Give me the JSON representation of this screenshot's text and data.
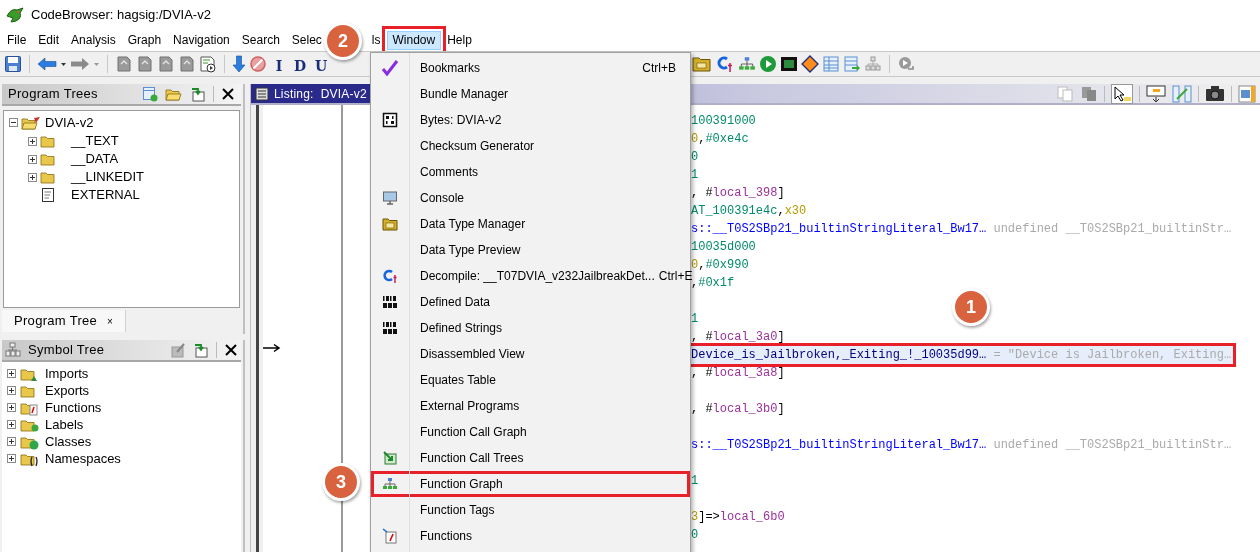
{
  "window": {
    "title": "CodeBrowser: hagsig:/DVIA-v2"
  },
  "menubar": [
    {
      "label": "File",
      "selected": false,
      "marked": false
    },
    {
      "label": "Edit",
      "selected": false,
      "marked": false
    },
    {
      "label": "Analysis",
      "selected": false,
      "marked": false
    },
    {
      "label": "Graph",
      "selected": false,
      "marked": false
    },
    {
      "label": "Navigation",
      "selected": false,
      "marked": false
    },
    {
      "label": "Search",
      "selected": false,
      "marked": false
    },
    {
      "label": "Selec",
      "selected": false,
      "marked": false
    },
    {
      "label": "ls",
      "selected": false,
      "marked": false
    },
    {
      "label": "Window",
      "selected": true,
      "marked": true
    },
    {
      "label": "Help",
      "selected": false,
      "marked": false
    }
  ],
  "toolbar": {
    "letter_buttons": [
      "I",
      "D",
      "U"
    ]
  },
  "program_trees": {
    "title": "Program Trees",
    "tree": [
      {
        "label": "DVIA-v2",
        "kind": "program",
        "expanded": true,
        "children": [
          {
            "label": "__TEXT",
            "kind": "folder",
            "expanded": false
          },
          {
            "label": "__DATA",
            "kind": "folder",
            "expanded": false
          },
          {
            "label": "__LINKEDIT",
            "kind": "folder",
            "expanded": false
          },
          {
            "label": "EXTERNAL",
            "kind": "file"
          }
        ]
      }
    ],
    "tab": {
      "label": "Program Tree",
      "close": "×"
    }
  },
  "symbol_tree": {
    "title": "Symbol Tree",
    "items": [
      {
        "label": "Imports",
        "kind": "imports",
        "expanded": false
      },
      {
        "label": "Exports",
        "kind": "exports",
        "expanded": false
      },
      {
        "label": "Functions",
        "kind": "functions",
        "expanded": false
      },
      {
        "label": "Labels",
        "kind": "labels",
        "expanded": false
      },
      {
        "label": "Classes",
        "kind": "classes",
        "expanded": false
      },
      {
        "label": "Namespaces",
        "kind": "namespaces",
        "expanded": false
      }
    ]
  },
  "listing": {
    "title": "Listing:  DVIA-v2",
    "lines": [
      {
        "kind": "code",
        "selected": false,
        "marked": false,
        "parts": [
          {
            "kind": "number",
            "text": "100391000"
          }
        ]
      },
      {
        "kind": "code",
        "selected": false,
        "marked": false,
        "parts": [
          {
            "kind": "register",
            "text": "0"
          },
          {
            "kind": "plain",
            "text": ","
          },
          {
            "kind": "number",
            "text": "#0xe4c"
          }
        ]
      },
      {
        "kind": "code",
        "selected": false,
        "marked": false,
        "parts": [
          {
            "kind": "number",
            "text": "0"
          }
        ]
      },
      {
        "kind": "code",
        "selected": false,
        "marked": false,
        "parts": [
          {
            "kind": "number",
            "text": "1"
          }
        ]
      },
      {
        "kind": "code",
        "selected": false,
        "marked": false,
        "parts": [
          {
            "kind": "plain",
            "text": ", #"
          },
          {
            "kind": "label",
            "text": "local_398"
          },
          {
            "kind": "plain",
            "text": "]"
          }
        ]
      },
      {
        "kind": "code",
        "selected": false,
        "marked": false,
        "parts": [
          {
            "kind": "number",
            "text": "AT_100391e4c"
          },
          {
            "kind": "plain",
            "text": ","
          },
          {
            "kind": "register",
            "text": "x30"
          }
        ]
      },
      {
        "kind": "code",
        "selected": false,
        "marked": false,
        "parts": [
          {
            "kind": "reference",
            "text": "s::__T0S2SBp21_builtinStringLiteral_Bw17…"
          },
          {
            "kind": "comment",
            "text": " undefined __T0S2SBp21_builtinStr…"
          }
        ]
      },
      {
        "kind": "code",
        "selected": false,
        "marked": false,
        "parts": [
          {
            "kind": "number",
            "text": "10035d000"
          }
        ]
      },
      {
        "kind": "code",
        "selected": false,
        "marked": false,
        "parts": [
          {
            "kind": "register",
            "text": "0"
          },
          {
            "kind": "plain",
            "text": ","
          },
          {
            "kind": "number",
            "text": "#0x990"
          }
        ]
      },
      {
        "kind": "code",
        "selected": false,
        "marked": false,
        "parts": [
          {
            "kind": "plain",
            "text": ","
          },
          {
            "kind": "number",
            "text": "#0x1f"
          }
        ]
      },
      {
        "kind": "blank"
      },
      {
        "kind": "code",
        "selected": false,
        "marked": false,
        "parts": [
          {
            "kind": "number",
            "text": "1"
          }
        ]
      },
      {
        "kind": "code",
        "selected": false,
        "marked": false,
        "parts": [
          {
            "kind": "plain",
            "text": ", #"
          },
          {
            "kind": "label",
            "text": "local_3a0"
          },
          {
            "kind": "plain",
            "text": "]"
          }
        ]
      },
      {
        "kind": "code",
        "selected": true,
        "marked": true,
        "parts": [
          {
            "kind": "symbol",
            "text": "Device_is_Jailbroken,_Exiting_!_10035d99…"
          },
          {
            "kind": "comment",
            "text": " = \"Device is Jailbroken, Exiting…"
          }
        ]
      },
      {
        "kind": "code",
        "selected": false,
        "marked": false,
        "parts": [
          {
            "kind": "plain",
            "text": ", #"
          },
          {
            "kind": "label",
            "text": "local_3a8"
          },
          {
            "kind": "plain",
            "text": "]"
          }
        ]
      },
      {
        "kind": "blank"
      },
      {
        "kind": "code",
        "selected": false,
        "marked": false,
        "parts": [
          {
            "kind": "plain",
            "text": ", #"
          },
          {
            "kind": "label",
            "text": "local_3b0"
          },
          {
            "kind": "plain",
            "text": "]"
          }
        ]
      },
      {
        "kind": "blank"
      },
      {
        "kind": "code",
        "selected": false,
        "marked": false,
        "parts": [
          {
            "kind": "reference",
            "text": "s::__T0S2SBp21_builtinStringLiteral_Bw17…"
          },
          {
            "kind": "comment",
            "text": " undefined __T0S2SBp21_builtinStr…"
          }
        ]
      },
      {
        "kind": "blank"
      },
      {
        "kind": "code",
        "selected": false,
        "marked": false,
        "parts": [
          {
            "kind": "number",
            "text": "1"
          }
        ]
      },
      {
        "kind": "blank"
      },
      {
        "kind": "code",
        "selected": false,
        "marked": false,
        "parts": [
          {
            "kind": "register",
            "text": "3"
          },
          {
            "kind": "plain",
            "text": "]=>"
          },
          {
            "kind": "label",
            "text": "local_6b0"
          }
        ]
      },
      {
        "kind": "code",
        "selected": false,
        "marked": false,
        "parts": [
          {
            "kind": "number",
            "text": "0"
          }
        ]
      }
    ]
  },
  "window_menu": {
    "items": [
      {
        "label": "Bookmarks",
        "shortcut": "Ctrl+B",
        "kind": "check",
        "marked": false
      },
      {
        "label": "Bundle Manager",
        "marked": false
      },
      {
        "label": "Bytes: DVIA-v2",
        "kind": "bytes",
        "marked": false
      },
      {
        "label": "Checksum Generator",
        "marked": false
      },
      {
        "label": "Comments",
        "marked": false
      },
      {
        "label": "Console",
        "kind": "monitor",
        "marked": false
      },
      {
        "label": "Data Type Manager",
        "kind": "folder",
        "marked": false
      },
      {
        "label": "Data Type Preview",
        "marked": false
      },
      {
        "label": "Decompile: __T07DVIA_v232JailbreakDet...",
        "shortcut": "Ctrl+E",
        "kind": "decompile",
        "marked": false
      },
      {
        "label": "Defined Data",
        "kind": "data",
        "marked": false
      },
      {
        "label": "Defined Strings",
        "kind": "data",
        "marked": false
      },
      {
        "label": "Disassembled View",
        "marked": false
      },
      {
        "label": "Equates Table",
        "marked": false
      },
      {
        "label": "External Programs",
        "marked": false
      },
      {
        "label": "Function Call Graph",
        "marked": false
      },
      {
        "label": "Function Call Trees",
        "kind": "calltree",
        "marked": false
      },
      {
        "label": "Function Graph",
        "kind": "graph",
        "marked": true
      },
      {
        "label": "Function Tags",
        "marked": false
      },
      {
        "label": "Functions",
        "kind": "functions",
        "marked": false
      }
    ]
  },
  "callouts": [
    {
      "label": "2"
    },
    {
      "label": "3"
    },
    {
      "label": "1"
    }
  ]
}
